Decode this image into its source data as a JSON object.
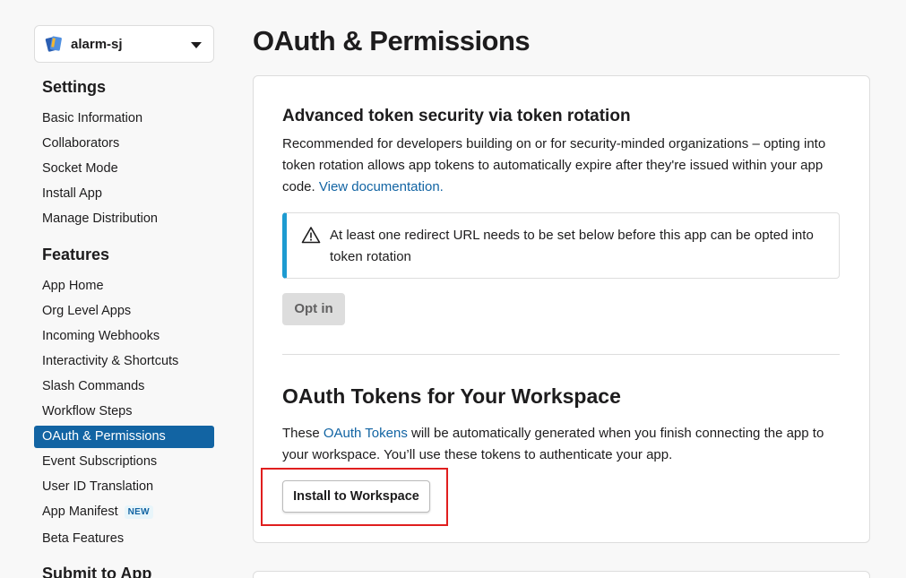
{
  "sidebar": {
    "app_name": "alarm-sj",
    "sections": [
      {
        "title": "Settings"
      },
      {
        "title": "Features"
      },
      {
        "title": "Submit to App"
      }
    ],
    "settings_items": [
      "Basic Information",
      "Collaborators",
      "Socket Mode",
      "Install App",
      "Manage Distribution"
    ],
    "features_items": [
      "App Home",
      "Org Level Apps",
      "Incoming Webhooks",
      "Interactivity & Shortcuts",
      "Slash Commands",
      "Workflow Steps",
      "OAuth & Permissions",
      "Event Subscriptions",
      "User ID Translation",
      "App Manifest",
      "Beta Features"
    ],
    "active_item": "OAuth & Permissions",
    "new_badge": "NEW"
  },
  "main": {
    "page_title": "OAuth & Permissions",
    "token_rotation": {
      "heading": "Advanced token security via token rotation",
      "description": "Recommended for developers building on or for security-minded organizations – opting into token rotation allows app tokens to automatically expire after they're issued within your app code.",
      "link": "View documentation.",
      "warning": "At least one redirect URL needs to be set below before this app can be opted into token rotation",
      "opt_in_button": "Opt in"
    },
    "oauth_tokens": {
      "heading": "OAuth Tokens for Your Workspace",
      "description_prefix": "These",
      "description_link": "OAuth Tokens",
      "description_suffix": "will be automatically generated when you finish connecting the app to your workspace. You’ll use these tokens to authenticate your app.",
      "install_button": "Install to Workspace"
    }
  },
  "colors": {
    "accent": "#1264a3",
    "warning_bar": "#1d9bd1",
    "highlight": "#e01e1e"
  }
}
